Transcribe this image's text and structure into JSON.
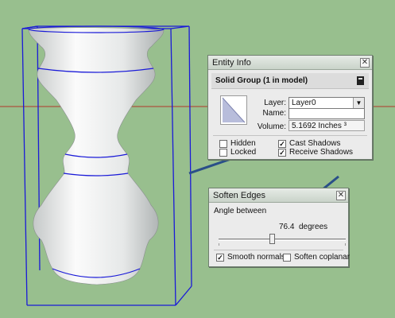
{
  "entity_info": {
    "title": "Entity Info",
    "close_icon": "close-icon",
    "header": "Solid Group (1 in model)",
    "menu_icon": "details-menu-icon",
    "layer_label": "Layer:",
    "layer_value": "Layer0",
    "name_label": "Name:",
    "name_value": "",
    "volume_label": "Volume:",
    "volume_value": "5.1692 Inches ³",
    "hidden_label": "Hidden",
    "hidden_checked": false,
    "locked_label": "Locked",
    "locked_checked": false,
    "cast_shadows_label": "Cast Shadows",
    "cast_shadows_checked": true,
    "receive_shadows_label": "Receive Shadows",
    "receive_shadows_checked": true
  },
  "soften_edges": {
    "title": "Soften Edges",
    "close_icon": "close-icon",
    "angle_label": "Angle between",
    "angle_value": "76.4",
    "angle_unit": "degrees",
    "slider_fraction": 0.42,
    "smooth_normals_label": "Smooth normals",
    "smooth_normals_checked": true,
    "soften_coplanar_label": "Soften coplanar",
    "soften_coplanar_checked": false
  },
  "colors": {
    "background": "#98bf8e",
    "bounding_box": "#1a1ad8",
    "red_axis": "#b23a2a",
    "callout_arrow": "#2a4f88"
  }
}
